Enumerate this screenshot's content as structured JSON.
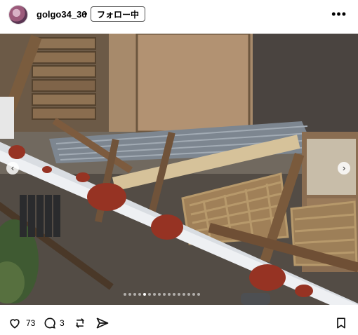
{
  "post": {
    "username": "golgo34_36",
    "separator": "•",
    "follow_label": "フォロー中",
    "more": "•••"
  },
  "media": {
    "current_index": 5,
    "total": 16
  },
  "actions": {
    "likes": "73",
    "comments": "3"
  },
  "icons": {
    "avatar": "profile-avatar",
    "more": "more-icon",
    "prev": "chevron-left-icon",
    "next": "chevron-right-icon",
    "like": "heart-icon",
    "comment": "comment-icon",
    "repost": "repost-icon",
    "share": "paper-plane-icon",
    "save": "bookmark-icon"
  }
}
